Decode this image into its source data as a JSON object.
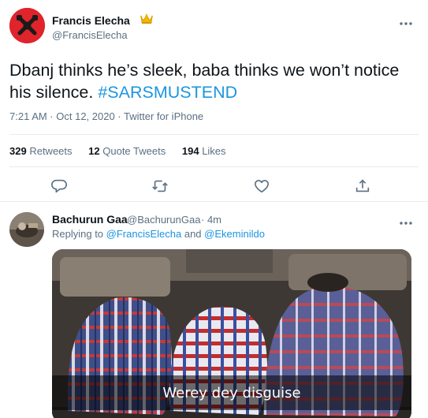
{
  "tweet": {
    "author_name": "Francis Elecha",
    "author_badge": "crown-emoji",
    "author_handle": "@FrancisElecha",
    "text_main": "Dbanj thinks he’s sleek, baba thinks we won’t notice his silence. ",
    "hashtag": "#SARSMUSTEND",
    "meta": "7:21 AM · Oct 12, 2020 · Twitter for iPhone",
    "stats": {
      "retweets_count": "329",
      "retweets_label": "Retweets",
      "quotes_count": "12",
      "quotes_label": "Quote Tweets",
      "likes_count": "194",
      "likes_label": "Likes"
    },
    "actions": [
      "reply-icon",
      "retweet-icon",
      "like-icon",
      "share-icon"
    ]
  },
  "reply": {
    "author_name": "Bachurun Gaa",
    "author_handle": "@BachurunGaa",
    "time": "· 4m",
    "replying_prefix": "Replying to ",
    "mention_1": "@FrancisElecha",
    "replying_and": " and ",
    "mention_2": "@Ekeminildo",
    "media_caption": "Werey dey disguise"
  },
  "colors": {
    "link": "#1b95e0",
    "secondary_text": "#5b7083",
    "divider": "#e6ecf0",
    "avatar_main": "#e0242c"
  }
}
